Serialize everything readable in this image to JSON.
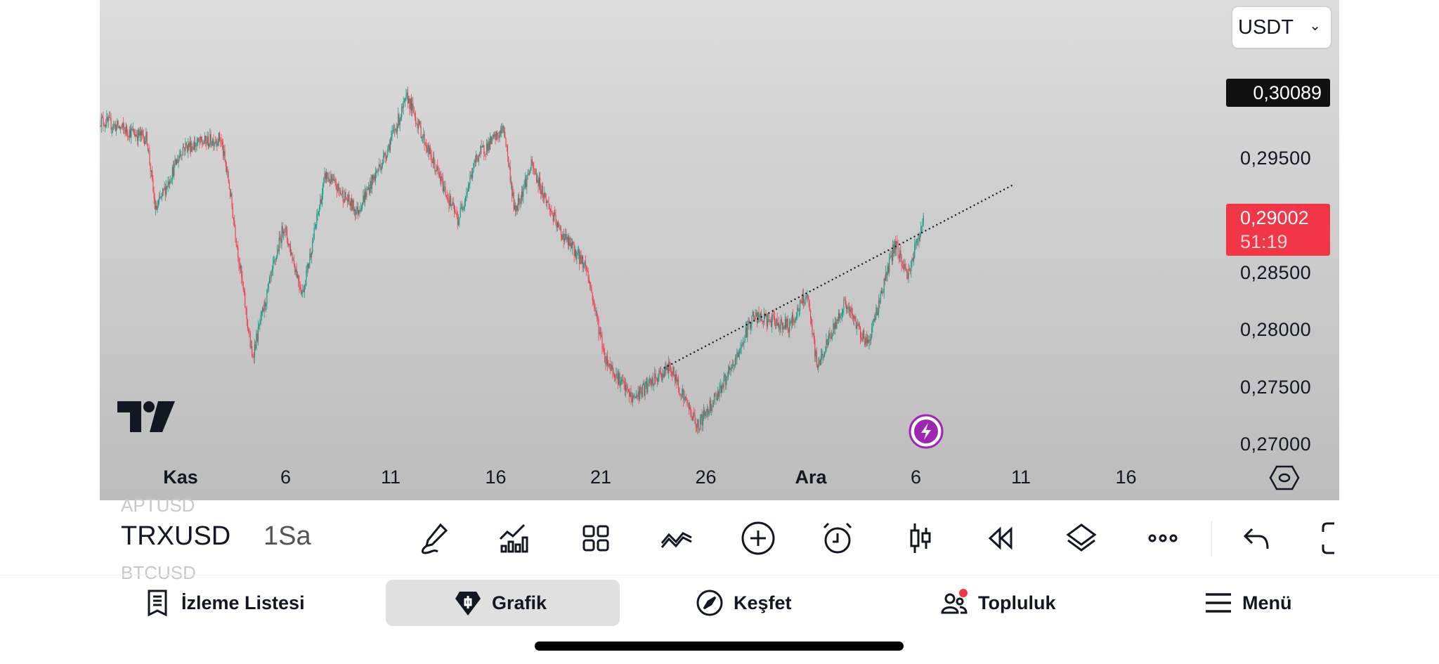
{
  "chart": {
    "currency_selector": "USDT",
    "high_badge": "0,30089",
    "last_price_badge": "0,29002",
    "countdown": "51:19",
    "colors": {
      "up": "#089981",
      "down": "#f23645",
      "bg_top": "#dcdcdc",
      "bg_bottom": "#bcbcbc"
    }
  },
  "chart_data": {
    "type": "candlestick",
    "symbol": "TRXUSD",
    "interval": "1Sa",
    "y_ticks": [
      "0,29500",
      "0,28500",
      "0,28000",
      "0,27500",
      "0,27000"
    ],
    "y_tick_values": [
      0.295,
      0.285,
      0.28,
      0.275,
      0.27
    ],
    "x_ticks": [
      {
        "label": "Kas",
        "day": 0,
        "bold": true
      },
      {
        "label": "6",
        "day": 5
      },
      {
        "label": "11",
        "day": 10
      },
      {
        "label": "16",
        "day": 15
      },
      {
        "label": "21",
        "day": 20
      },
      {
        "label": "26",
        "day": 25
      },
      {
        "label": "Ara",
        "day": 30,
        "bold": true
      },
      {
        "label": "6",
        "day": 35
      },
      {
        "label": "11",
        "day": 40
      },
      {
        "label": "16",
        "day": 45
      }
    ],
    "approx_path_day_price": [
      [
        -3.85,
        0.2984
      ],
      [
        -1.6,
        0.2968
      ],
      [
        -1.2,
        0.2904
      ],
      [
        0.1,
        0.296
      ],
      [
        1.9,
        0.2968
      ],
      [
        2.3,
        0.2928
      ],
      [
        3.4,
        0.2776
      ],
      [
        4.9,
        0.2892
      ],
      [
        5.8,
        0.2832
      ],
      [
        6.9,
        0.2936
      ],
      [
        8.4,
        0.2904
      ],
      [
        9.7,
        0.2952
      ],
      [
        10.8,
        0.3004
      ],
      [
        11.9,
        0.2952
      ],
      [
        13.2,
        0.2896
      ],
      [
        14.1,
        0.2952
      ],
      [
        15.4,
        0.2976
      ],
      [
        15.9,
        0.2904
      ],
      [
        16.7,
        0.2944
      ],
      [
        18.0,
        0.2888
      ],
      [
        19.3,
        0.2856
      ],
      [
        20.2,
        0.2776
      ],
      [
        21.5,
        0.274
      ],
      [
        23.3,
        0.2768
      ],
      [
        24.6,
        0.2716
      ],
      [
        26.3,
        0.2768
      ],
      [
        27.2,
        0.2812
      ],
      [
        29.0,
        0.2804
      ],
      [
        29.8,
        0.2832
      ],
      [
        30.3,
        0.2768
      ],
      [
        31.6,
        0.2824
      ],
      [
        32.7,
        0.2788
      ],
      [
        34.0,
        0.2876
      ],
      [
        34.6,
        0.2848
      ],
      [
        35.4,
        0.29002
      ]
    ],
    "trendline": {
      "from": [
        23.0,
        0.2767
      ],
      "to": [
        39.6,
        0.2927
      ],
      "style": "dotted"
    }
  },
  "toolbar": {
    "symbol": "TRXUSD",
    "symbol_prev": "APTUSD",
    "symbol_next": "BTCUSD",
    "interval": "1Sa",
    "icons": [
      "drawing-pen-icon",
      "indicators-icon",
      "layouts-grid-icon",
      "compare-icon",
      "add-icon",
      "alert-clock-icon",
      "candle-type-icon",
      "replay-icon",
      "layers-icon",
      "more-icon",
      "undo-icon",
      "fullscreen-icon"
    ]
  },
  "nav": {
    "items": [
      {
        "label": "İzleme Listesi",
        "icon": "watchlist-icon"
      },
      {
        "label": "Grafik",
        "icon": "chart-icon",
        "active": true
      },
      {
        "label": "Keşfet",
        "icon": "compass-icon"
      },
      {
        "label": "Topluluk",
        "icon": "community-icon",
        "badge": true
      },
      {
        "label": "Menü",
        "icon": "menu-icon"
      }
    ]
  }
}
